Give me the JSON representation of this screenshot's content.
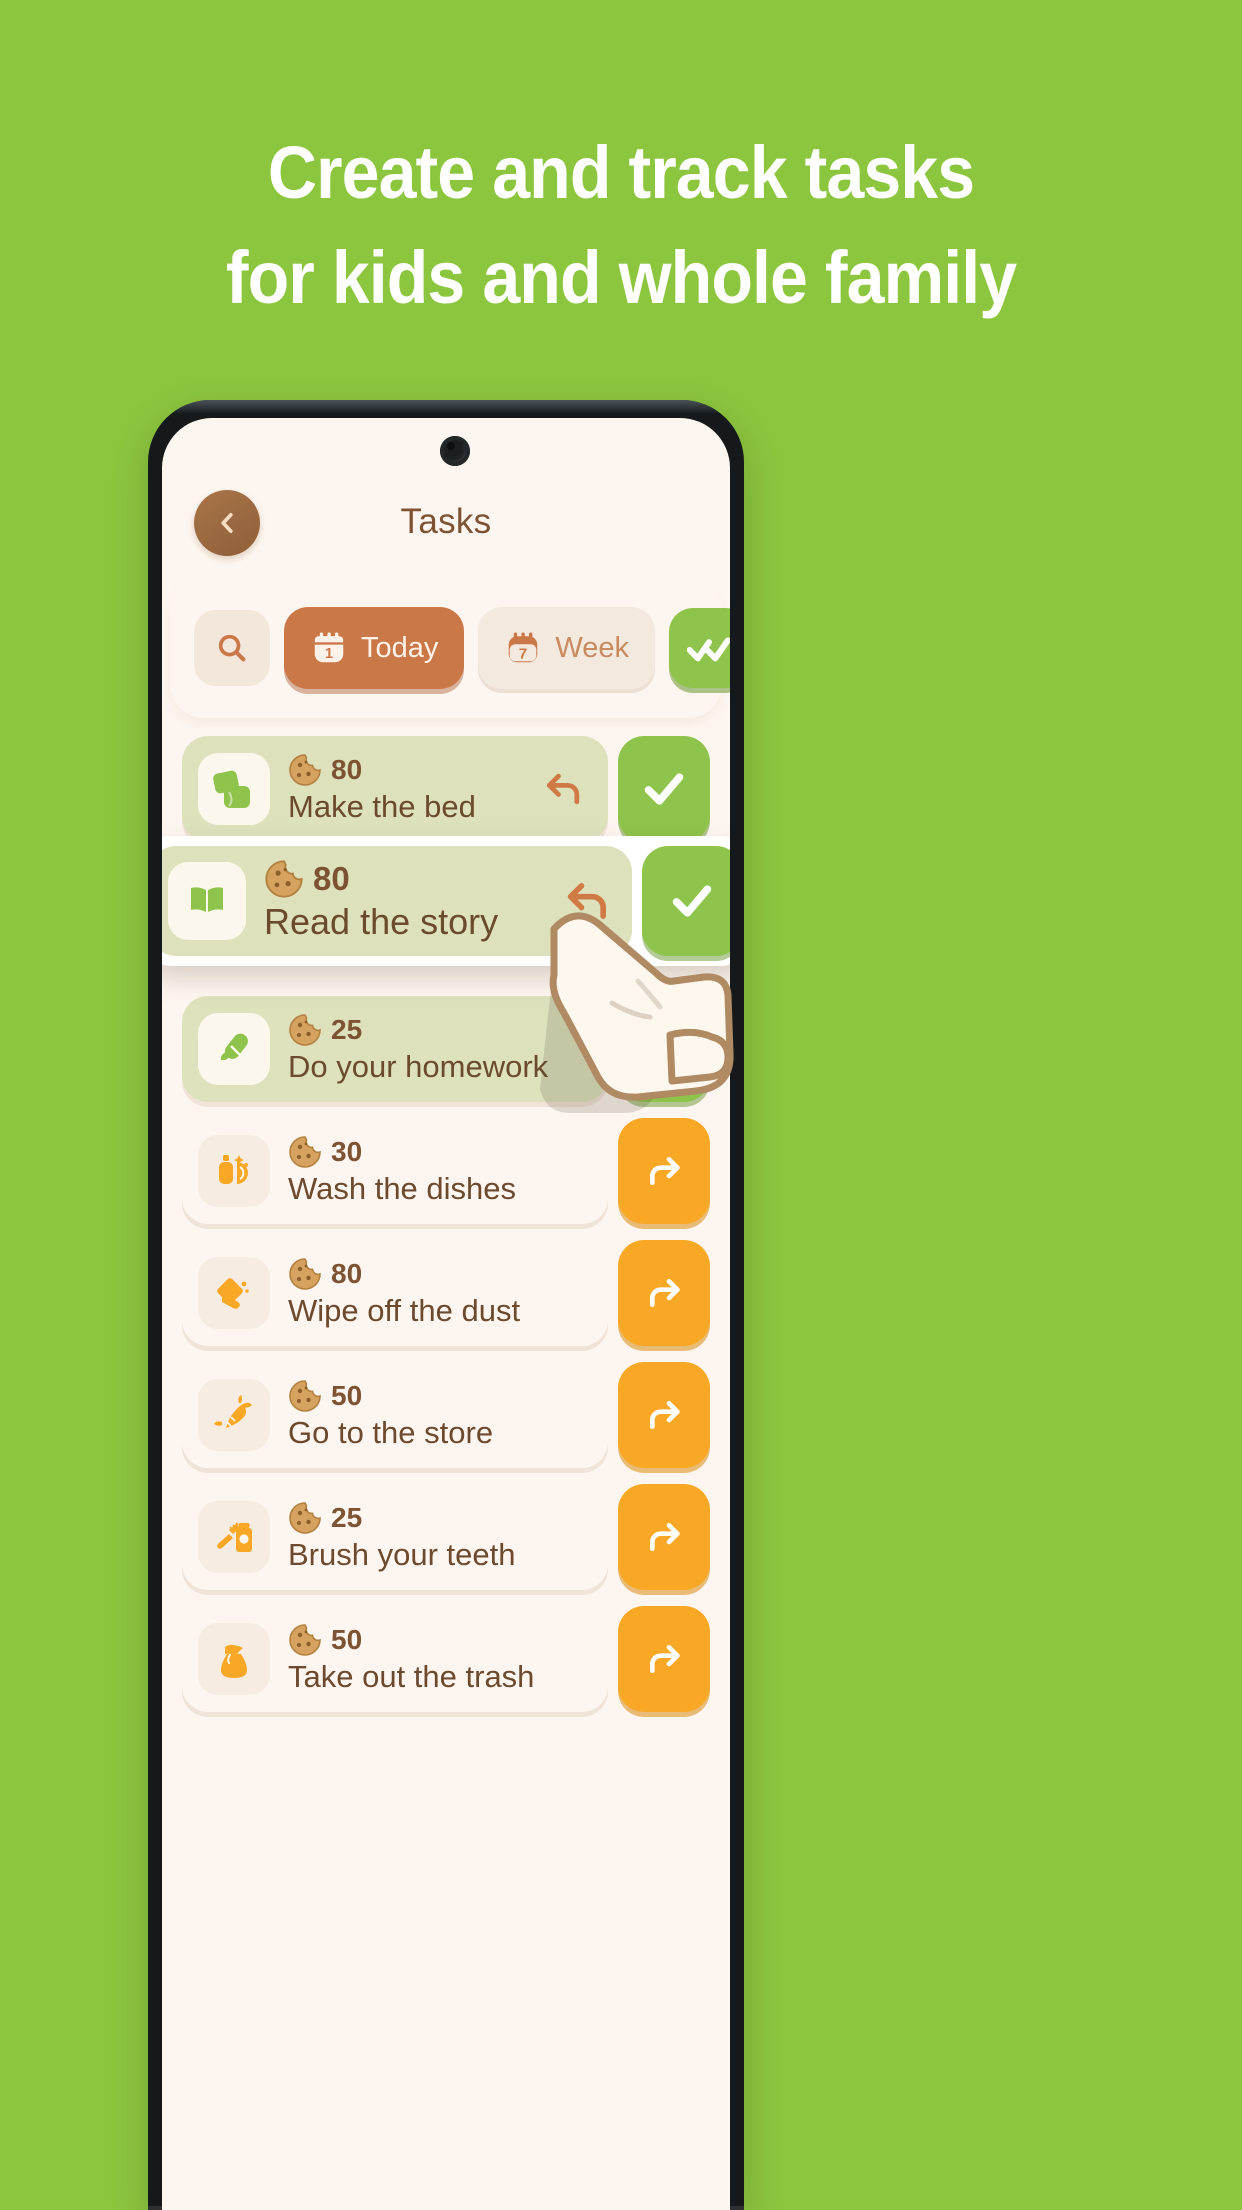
{
  "promo": {
    "headline_line1": "Create and track tasks",
    "headline_line2": "for kids and whole family",
    "background_color": "#8cc63f",
    "text_color": "#ffffff"
  },
  "phone": {
    "screen_background": "#fdf6f0"
  },
  "app": {
    "header": {
      "back_icon": "chevron-left-icon",
      "title": "Tasks"
    },
    "toolbar": {
      "search_icon": "search-icon",
      "tabs": [
        {
          "label": "Today",
          "icon": "calendar-day-icon",
          "badge": "1",
          "active": true
        },
        {
          "label": "Week",
          "icon": "calendar-week-icon",
          "badge": "7",
          "active": false
        }
      ],
      "complete_all_icon": "double-check-icon",
      "active_tab_color": "#cb7848",
      "inactive_tab_color": "#f3e9de",
      "complete_all_color": "#8ec44b"
    },
    "tasks": [
      {
        "title": "Make the bed",
        "reward": "80",
        "emoji": "bed-pillow-icon",
        "state": "done",
        "action_icon": "check-icon",
        "action_color": "#8ec44b",
        "has_undo": true,
        "highlighted": false
      },
      {
        "title": "Read the story",
        "reward": "80",
        "emoji": "open-book-icon",
        "state": "done",
        "action_icon": "check-icon",
        "action_color": "#8ec44b",
        "has_undo": true,
        "highlighted": true
      },
      {
        "title": "Do your homework",
        "reward": "25",
        "emoji": "crayon-icon",
        "state": "done",
        "action_icon": "check-icon",
        "action_color": "#8ec44b",
        "has_undo": false,
        "highlighted": false
      },
      {
        "title": "Wash the dishes",
        "reward": "30",
        "emoji": "dish-soap-icon",
        "state": "todo",
        "action_icon": "arrow-forward-icon",
        "action_color": "#f9a825",
        "has_undo": false,
        "highlighted": false
      },
      {
        "title": "Wipe off the dust",
        "reward": "80",
        "emoji": "cleaning-hand-icon",
        "state": "todo",
        "action_icon": "arrow-forward-icon",
        "action_color": "#f9a825",
        "has_undo": false,
        "highlighted": false
      },
      {
        "title": "Go to the store",
        "reward": "50",
        "emoji": "carrot-icon",
        "state": "todo",
        "action_icon": "arrow-forward-icon",
        "action_color": "#f9a825",
        "has_undo": false,
        "highlighted": false
      },
      {
        "title": "Brush your teeth",
        "reward": "25",
        "emoji": "toothbrush-icon",
        "state": "todo",
        "action_icon": "arrow-forward-icon",
        "action_color": "#f9a825",
        "has_undo": false,
        "highlighted": false
      },
      {
        "title": "Take out the trash",
        "reward": "50",
        "emoji": "trash-bag-icon",
        "state": "todo",
        "action_icon": "arrow-forward-icon",
        "action_color": "#f9a825",
        "has_undo": false,
        "highlighted": false
      }
    ],
    "pointer": "hand-tap-cursor"
  }
}
